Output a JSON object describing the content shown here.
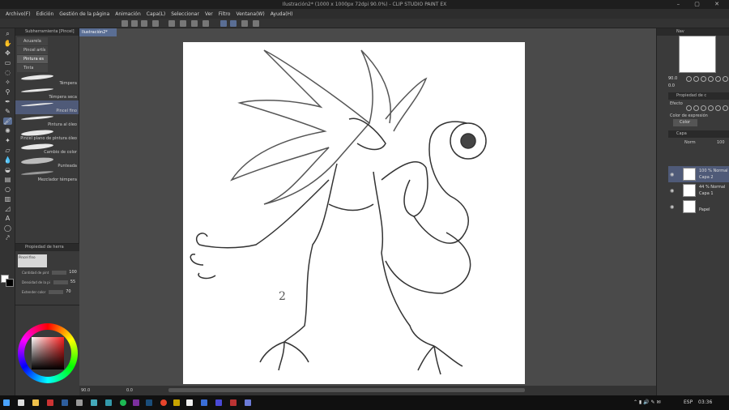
{
  "window": {
    "title": "Ilustración2* (1000 x 1000px 72dpi 90.0%) - CLIP STUDIO PAINT EX",
    "controls": "– ▢ ✕"
  },
  "menu": [
    "Archivo(F)",
    "Edición",
    "Gestión de la página",
    "Animación",
    "Capa(L)",
    "Seleccionar",
    "Ver",
    "Filtro",
    "Ventana(W)",
    "Ayuda(H)"
  ],
  "subtool": {
    "header": "Subherramienta [Pincel]",
    "tabs": [
      "Acuarela",
      "Pincel artís",
      "Pintura es",
      "Tinta"
    ],
    "brushes": [
      "Témpera",
      "Témpera seca",
      "Pincel fino",
      "Pintura al óleo",
      "Pincel plano de pintura óleo",
      "Cambio de color",
      "Punteada",
      "Mezclador témpera"
    ],
    "active_brush": "Pincel fino"
  },
  "tool_property": {
    "header": "Propiedad de herra",
    "preview_label": "Pincel fino",
    "rows": [
      {
        "label": "Cantidad de pint",
        "value": "100"
      },
      {
        "label": "Densidad de la pi",
        "value": "55"
      },
      {
        "label": "Extender color",
        "value": "70"
      }
    ]
  },
  "document": {
    "tab": "Ilustración2*",
    "zoom": "90.0",
    "angle": "0.0"
  },
  "navigator": {
    "header": "Nav",
    "zoom": "90.0",
    "angle": "0.0"
  },
  "layer_property": {
    "header": "Propiedad de c",
    "effect_label": "Efecto",
    "expression_label": "Color de expresión",
    "expression_value": "Color"
  },
  "layers": {
    "header": "Capa",
    "blend": "Norm",
    "opacity": "100",
    "items": [
      {
        "line1": "100 % Normal",
        "line2": "Capa 2"
      },
      {
        "line1": "44 % Normal",
        "line2": "Capa 1"
      },
      {
        "line1": "",
        "line2": "Papel"
      }
    ]
  },
  "taskbar": {
    "lang": "ESP",
    "time": "03:36"
  },
  "canvas_annotation": "2"
}
